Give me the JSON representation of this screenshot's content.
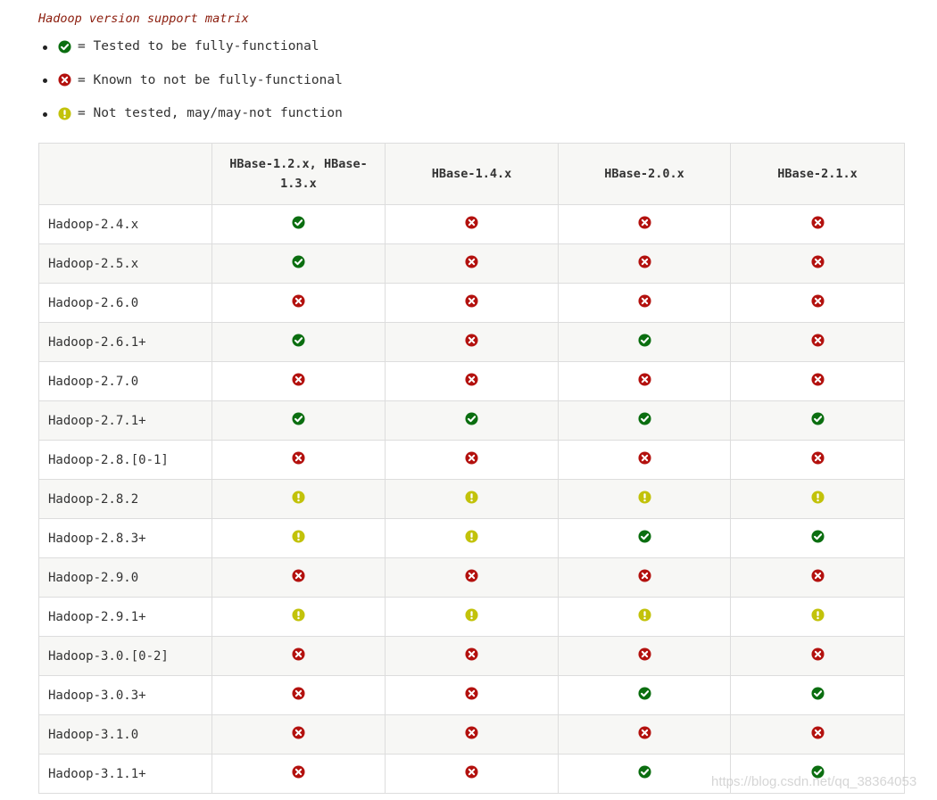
{
  "caption": "Hadoop version support matrix",
  "legend": [
    {
      "icon": "check-icon",
      "text": "= Tested to be fully-functional"
    },
    {
      "icon": "cross-icon",
      "text": "= Known to not be fully-functional"
    },
    {
      "icon": "warning-icon",
      "text": "= Not tested, may/may-not function"
    }
  ],
  "colors": {
    "check": "#0b6e10",
    "cross": "#b3110e",
    "warning": "#c2c20a",
    "caption": "#8b1c0c",
    "header_bg": "#f7f7f5",
    "border": "#dddddd"
  },
  "table": {
    "corner": "",
    "columns": [
      "HBase-1.2.x, HBase-1.3.x",
      "HBase-1.4.x",
      "HBase-2.0.x",
      "HBase-2.1.x"
    ],
    "rows": [
      {
        "label": "Hadoop-2.4.x",
        "cells": [
          "check",
          "cross",
          "cross",
          "cross"
        ]
      },
      {
        "label": "Hadoop-2.5.x",
        "cells": [
          "check",
          "cross",
          "cross",
          "cross"
        ]
      },
      {
        "label": "Hadoop-2.6.0",
        "cells": [
          "cross",
          "cross",
          "cross",
          "cross"
        ]
      },
      {
        "label": "Hadoop-2.6.1+",
        "cells": [
          "check",
          "cross",
          "check",
          "cross"
        ]
      },
      {
        "label": "Hadoop-2.7.0",
        "cells": [
          "cross",
          "cross",
          "cross",
          "cross"
        ]
      },
      {
        "label": "Hadoop-2.7.1+",
        "cells": [
          "check",
          "check",
          "check",
          "check"
        ]
      },
      {
        "label": "Hadoop-2.8.[0-1]",
        "cells": [
          "cross",
          "cross",
          "cross",
          "cross"
        ]
      },
      {
        "label": "Hadoop-2.8.2",
        "cells": [
          "warning",
          "warning",
          "warning",
          "warning"
        ]
      },
      {
        "label": "Hadoop-2.8.3+",
        "cells": [
          "warning",
          "warning",
          "check",
          "check"
        ]
      },
      {
        "label": "Hadoop-2.9.0",
        "cells": [
          "cross",
          "cross",
          "cross",
          "cross"
        ]
      },
      {
        "label": "Hadoop-2.9.1+",
        "cells": [
          "warning",
          "warning",
          "warning",
          "warning"
        ]
      },
      {
        "label": "Hadoop-3.0.[0-2]",
        "cells": [
          "cross",
          "cross",
          "cross",
          "cross"
        ]
      },
      {
        "label": "Hadoop-3.0.3+",
        "cells": [
          "cross",
          "cross",
          "check",
          "check"
        ]
      },
      {
        "label": "Hadoop-3.1.0",
        "cells": [
          "cross",
          "cross",
          "cross",
          "cross"
        ]
      },
      {
        "label": "Hadoop-3.1.1+",
        "cells": [
          "cross",
          "cross",
          "check",
          "check"
        ]
      }
    ]
  },
  "watermark": "https://blog.csdn.net/qq_38364053"
}
